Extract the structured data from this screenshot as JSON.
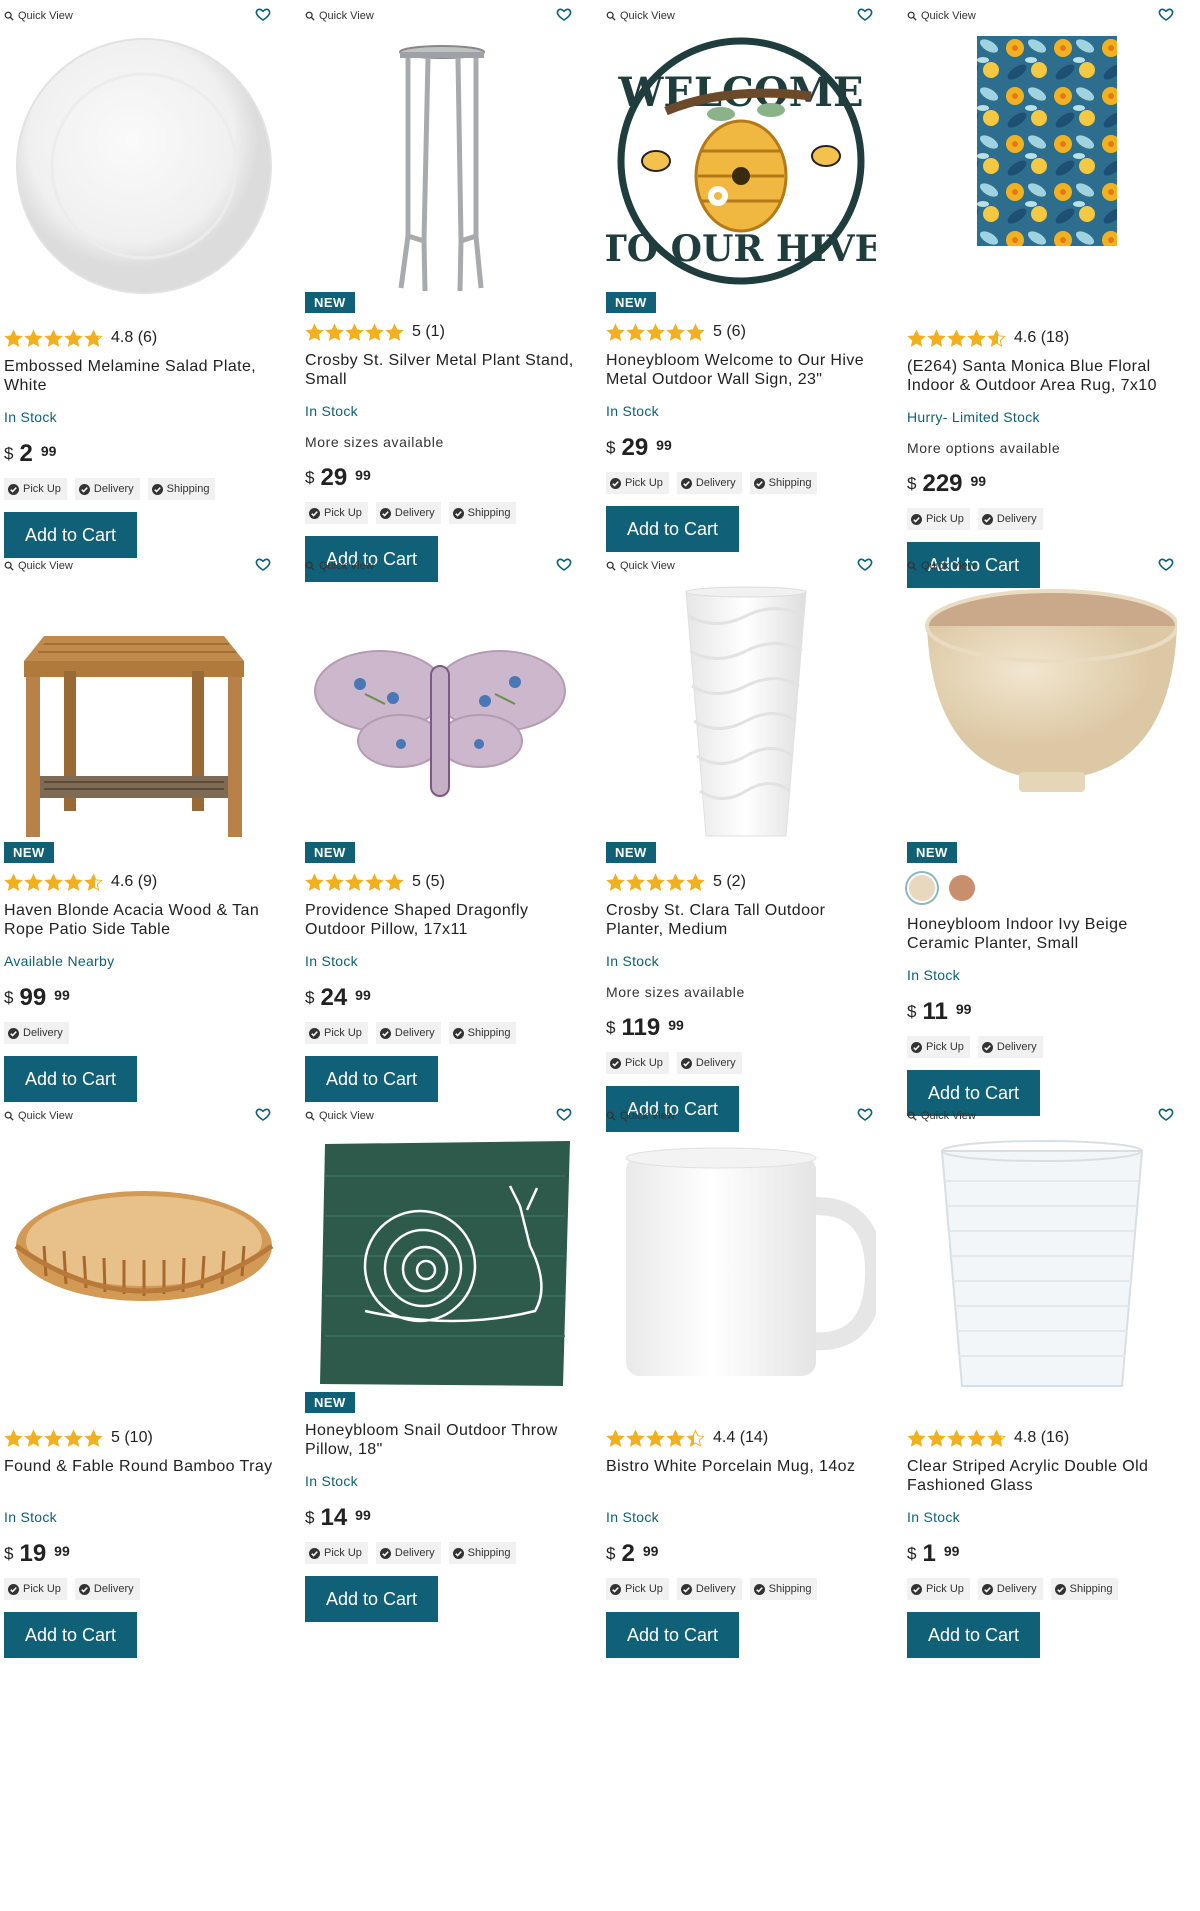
{
  "labels": {
    "quick_view": "Quick View",
    "add_to_cart": "Add to Cart",
    "new_badge": "NEW",
    "currency": "$",
    "pick_up": "Pick Up",
    "delivery": "Delivery",
    "shipping": "Shipping"
  },
  "colors": {
    "accent": "#106077",
    "star": "#f2b01e"
  },
  "products": [
    {
      "name": "Embossed Melamine Salad Plate, White",
      "rating": 4.8,
      "rating_text": "4.8 (6)",
      "is_new": false,
      "stock": "In Stock",
      "options": "",
      "dollars": "2",
      "cents": "99",
      "pickup": true,
      "delivery": true,
      "shipping": true,
      "image": "white-plate"
    },
    {
      "name": "Crosby St. Silver Metal Plant Stand, Small",
      "rating": 5,
      "rating_text": "5 (1)",
      "is_new": true,
      "stock": "In Stock",
      "options": "More sizes available",
      "dollars": "29",
      "cents": "99",
      "pickup": true,
      "delivery": true,
      "shipping": true,
      "image": "plant-stand"
    },
    {
      "name": "Honeybloom Welcome to Our Hive Metal Outdoor Wall Sign, 23\"",
      "rating": 5,
      "rating_text": "5 (6)",
      "is_new": true,
      "stock": "In Stock",
      "options": "",
      "dollars": "29",
      "cents": "99",
      "pickup": true,
      "delivery": true,
      "shipping": true,
      "image": "hive-sign"
    },
    {
      "name": "(E264) Santa Monica Blue Floral Indoor & Outdoor Area Rug, 7x10",
      "rating": 4.6,
      "rating_text": "4.6 (18)",
      "is_new": false,
      "stock": "Hurry- Limited Stock",
      "options": "More options available",
      "dollars": "229",
      "cents": "99",
      "pickup": true,
      "delivery": true,
      "shipping": false,
      "image": "floral-rug"
    },
    {
      "name": "Haven Blonde Acacia Wood & Tan Rope Patio Side Table",
      "rating": 4.6,
      "rating_text": "4.6 (9)",
      "is_new": true,
      "stock": "Available Nearby",
      "options": "",
      "dollars": "99",
      "cents": "99",
      "pickup": false,
      "delivery": true,
      "shipping": false,
      "image": "side-table"
    },
    {
      "name": "Providence Shaped Dragonfly Outdoor Pillow, 17x11",
      "rating": 5,
      "rating_text": "5 (5)",
      "is_new": true,
      "stock": "In Stock",
      "options": "",
      "dollars": "24",
      "cents": "99",
      "pickup": true,
      "delivery": true,
      "shipping": true,
      "image": "dragonfly-pillow"
    },
    {
      "name": "Crosby St. Clara Tall Outdoor Planter, Medium",
      "rating": 5,
      "rating_text": "5 (2)",
      "is_new": true,
      "stock": "In Stock",
      "options": "More sizes available",
      "dollars": "119",
      "cents": "99",
      "pickup": true,
      "delivery": true,
      "shipping": false,
      "image": "tall-planter"
    },
    {
      "name": "Honeybloom Indoor Ivy Beige Ceramic Planter, Small",
      "rating": null,
      "rating_text": "",
      "is_new": true,
      "stock": "In Stock",
      "options": "",
      "dollars": "11",
      "cents": "99",
      "pickup": true,
      "delivery": true,
      "shipping": false,
      "image": "beige-planter",
      "swatches": [
        "#e8d8bd",
        "#c98f6d"
      ]
    },
    {
      "name": "Found & Fable Round Bamboo Tray",
      "rating": 5,
      "rating_text": "5 (10)",
      "is_new": false,
      "stock": "In Stock",
      "options": "",
      "dollars": "19",
      "cents": "99",
      "pickup": true,
      "delivery": true,
      "shipping": false,
      "image": "bamboo-tray"
    },
    {
      "name": "Honeybloom Snail Outdoor Throw Pillow, 18\"",
      "rating": null,
      "rating_text": "",
      "is_new": true,
      "stock": "In Stock",
      "options": "",
      "dollars": "14",
      "cents": "99",
      "pickup": true,
      "delivery": true,
      "shipping": true,
      "image": "snail-pillow"
    },
    {
      "name": "Bistro White Porcelain Mug, 14oz",
      "rating": 4.4,
      "rating_text": "4.4 (14)",
      "is_new": false,
      "stock": "In Stock",
      "options": "",
      "dollars": "2",
      "cents": "99",
      "pickup": true,
      "delivery": true,
      "shipping": true,
      "image": "white-mug"
    },
    {
      "name": "Clear Striped Acrylic Double Old Fashioned Glass",
      "rating": 4.8,
      "rating_text": "4.8 (16)",
      "is_new": false,
      "stock": "In Stock",
      "options": "",
      "dollars": "1",
      "cents": "99",
      "pickup": true,
      "delivery": true,
      "shipping": true,
      "image": "acrylic-glass"
    }
  ]
}
